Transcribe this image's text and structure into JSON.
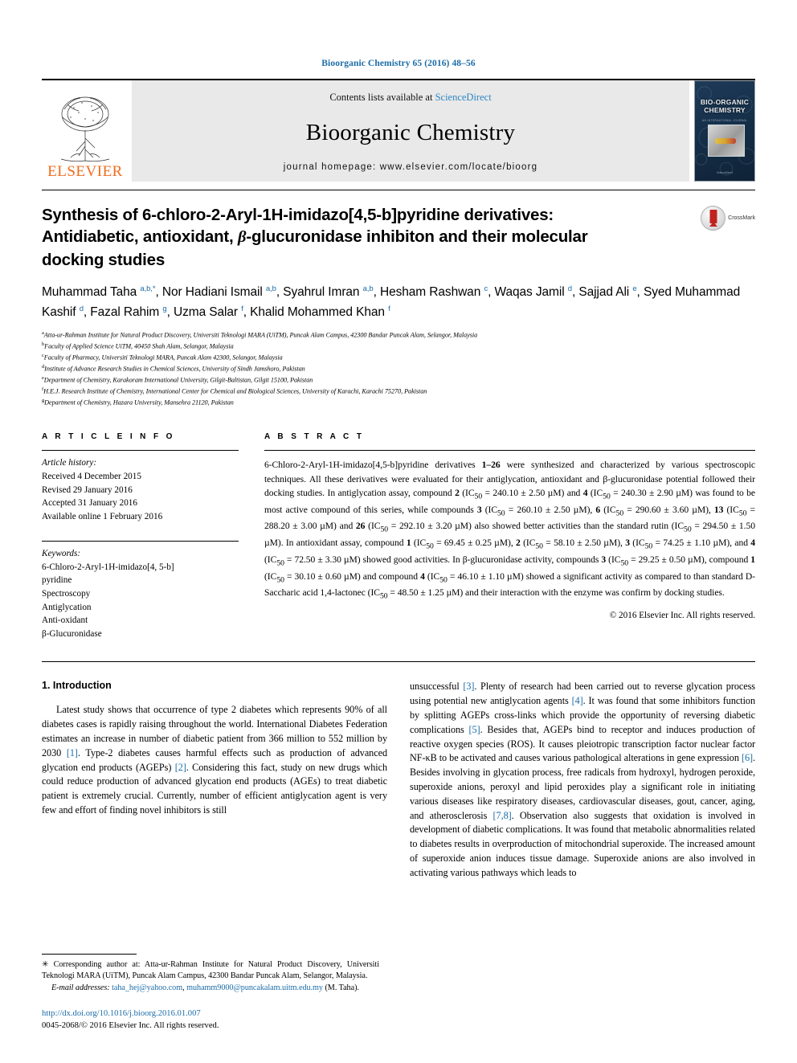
{
  "running_head": "Bioorganic Chemistry 65 (2016) 48–56",
  "masthead": {
    "publisher": "ELSEVIER",
    "contents_prefix": "Contents lists available at ",
    "sciencedirect": "ScienceDirect",
    "journal_name": "Bioorganic Chemistry",
    "homepage": "journal homepage: www.elsevier.com/locate/bioorg",
    "cover": {
      "line1": "BIO-ORGANIC",
      "line2": "CHEMISTRY",
      "sub": "AN INTERNATIONAL JOURNAL",
      "foot": "ScienceDirect"
    }
  },
  "article": {
    "title_line1": "Synthesis of 6-chloro-2-Aryl-1H-imidazo[4,5-b]pyridine derivatives:",
    "title_line2_pre": "Antidiabetic, antioxidant, ",
    "title_line2_beta": "β",
    "title_line2_post": "-glucuronidase inhibiton and their molecular",
    "title_line3": "docking studies",
    "crossmark_label": "CrossMark",
    "authors": [
      {
        "name": "Muhammad Taha ",
        "sup": "a,b,*",
        "sep": ", "
      },
      {
        "name": "Nor Hadiani Ismail ",
        "sup": "a,b",
        "sep": ", "
      },
      {
        "name": "Syahrul Imran ",
        "sup": "a,b",
        "sep": ", "
      },
      {
        "name": "Hesham Rashwan ",
        "sup": "c",
        "sep": ", "
      },
      {
        "name": "Waqas Jamil ",
        "sup": "d",
        "sep": ", "
      },
      {
        "name": "Sajjad Ali ",
        "sup": "e",
        "sep": ", "
      },
      {
        "name": "Syed Muhammad Kashif ",
        "sup": "d",
        "sep": ", "
      },
      {
        "name": "Fazal Rahim ",
        "sup": "g",
        "sep": ", "
      },
      {
        "name": "Uzma Salar ",
        "sup": "f",
        "sep": ", "
      },
      {
        "name": "Khalid Mohammed Khan ",
        "sup": "f",
        "sep": ""
      }
    ],
    "affiliations": [
      {
        "mark": "a",
        "text": "Atta-ur-Rahman Institute for Natural Product Discovery, Universiti Teknologi MARA (UiTM), Puncak Alam Campus, 42300 Bandar Puncak Alam, Selangor, Malaysia"
      },
      {
        "mark": "b",
        "text": "Faculty of Applied Science UiTM, 40450 Shah Alam, Selangor, Malaysia"
      },
      {
        "mark": "c",
        "text": "Faculty of Pharmacy, Universiti Teknologi MARA, Puncak Alam 42300, Selangor, Malaysia"
      },
      {
        "mark": "d",
        "text": "Institute of Advance Research Studies in Chemical Sciences, University of Sindh Jamshoro, Pakistan"
      },
      {
        "mark": "e",
        "text": "Department of Chemistry, Karakoram International University, Gilgit-Baltistan, Gilgit 15100, Pakistan"
      },
      {
        "mark": "f",
        "text": "H.E.J. Research Institute of Chemistry, International Center for Chemical and Biological Sciences, University of Karachi, Karachi 75270, Pakistan"
      },
      {
        "mark": "g",
        "text": "Department of Chemistry, Hazara University, Mansehra 21120, Pakistan"
      }
    ]
  },
  "article_info": {
    "heading": "A R T I C L E   I N F O",
    "history_label": "Article history:",
    "history": [
      "Received 4 December 2015",
      "Revised 29 January 2016",
      "Accepted 31 January 2016",
      "Available online 1 February 2016"
    ],
    "keywords_label": "Keywords:",
    "keywords": [
      "6-Chloro-2-Aryl-1H-imidazo[4, 5-b]",
      "pyridine",
      "Spectroscopy",
      "Antiglycation",
      "Anti-oxidant",
      "β-Glucuronidase"
    ]
  },
  "abstract": {
    "heading": "A B S T R A C T",
    "text_html": "6-Chloro-2-Aryl-1H-imidazo[4,5-b]pyridine derivatives <b>1&#8211;26</b> were synthesized and characterized by various spectroscopic techniques. All these derivatives were evaluated for their antiglycation, antioxidant and &#946;-glucuronidase potential followed their docking studies. In antiglycation assay, compound <b>2</b> (IC<sub>50</sub> = 240.10 &#177; 2.50 &#181;M) and <b>4</b> (IC<sub>50</sub> = 240.30 &#177; 2.90 &#181;M) was found to be most active compound of this series, while compounds <b>3</b> (IC<sub>50</sub> = 260.10 &#177; 2.50 &#181;M), <b>6</b> (IC<sub>50</sub> = 290.60 &#177; 3.60 &#181;M), <b>13</b> (IC<sub>50</sub> = 288.20 &#177; 3.00 &#181;M) and <b>26</b> (IC<sub>50</sub> = 292.10 &#177; 3.20 &#181;M) also showed better activities than the standard rutin (IC<sub>50</sub> = 294.50 &#177; 1.50 &#181;M). In antioxidant assay, compound <b>1</b> (IC<sub>50</sub> = 69.45 &#177; 0.25 &#181;M), <b>2</b> (IC<sub>50</sub> = 58.10 &#177; 2.50 &#181;M), <b>3</b> (IC<sub>50</sub> = 74.25 &#177; 1.10 &#181;M), and <b>4</b> (IC<sub>50</sub> = 72.50 &#177; 3.30 &#181;M) showed good activities. In &#946;-glucuronidase activity, compounds <b>3</b> (IC<sub>50</sub> = 29.25 &#177; 0.50 &#181;M), compound <b>1</b> (IC<sub>50</sub> = 30.10 &#177; 0.60 &#181;M) and compound <b>4</b> (IC<sub>50</sub> = 46.10 &#177; 1.10 &#181;M) showed a significant activity as compared to than standard D-Saccharic acid 1,4-lactonec (IC<sub>50</sub> = 48.50 &#177; 1.25 &#181;M) and their interaction with the enzyme was confirm by docking studies.",
    "copyright": "© 2016 Elsevier Inc. All rights reserved."
  },
  "introduction": {
    "heading": "1. Introduction",
    "left_html": "Latest study shows that occurrence of type 2 diabetes which represents 90% of all diabetes cases is rapidly raising throughout the world. International Diabetes Federation estimates an increase in number of diabetic patient from 366 million to 552 million by 2030 <span class=\"ref\">[1]</span>. Type-2 diabetes causes harmful effects such as production of advanced glycation end products (AGEPs) <span class=\"ref\">[2]</span>. Considering this fact, study on new drugs which could reduce production of advanced glycation end products (AGEs) to treat diabetic patient is extremely crucial. Currently, number of efficient antiglycation agent is very few and effort of finding novel inhibitors is still",
    "right_html": "unsuccessful <span class=\"ref\">[3]</span>. Plenty of research had been carried out to reverse glycation process using potential new antiglycation agents <span class=\"ref\">[4]</span>. It was found that some inhibitors function by splitting AGEPs cross-links which provide the opportunity of reversing diabetic complications <span class=\"ref\">[5]</span>. Besides that, AGEPs bind to receptor and induces production of reactive oxygen species (ROS). It causes pleiotropic transcription factor nuclear factor NF-&#954;B to be activated and causes various pathological alterations in gene expression <span class=\"ref\">[6]</span>. Besides involving in glycation process, free radicals from hydroxyl, hydrogen peroxide, superoxide anions, peroxyl and lipid peroxides play a significant role in initiating various diseases like respiratory diseases, cardiovascular diseases, gout, cancer, aging, and atherosclerosis <span class=\"ref\">[7,8]</span>. Observation also suggests that oxidation is involved in development of diabetic complications. It was found that metabolic abnormalities related to diabetes results in overproduction of mitochondrial superoxide. The increased amount of superoxide anion induces tissue damage. Superoxide anions are also involved in activating various pathways which leads to"
  },
  "footnote": {
    "corresponding_html": "&#10035; Corresponding author at: Atta-ur-Rahman Institute for Natural Product Discovery, Universiti Teknologi MARA (UiTM), Puncak Alam Campus, 42300 Bandar Puncak Alam, Selangor, Malaysia.",
    "email_html": "<span class=\"ital\">E-mail addresses:</span> <span class=\"link\">taha_hej@yahoo.com</span>, <span class=\"link\">muhamm9000@puncakalam.uitm.edu.my</span> (M. Taha).",
    "doi": "http://dx.doi.org/10.1016/j.bioorg.2016.01.007",
    "issn_line": "0045-2068/© 2016 Elsevier Inc. All rights reserved."
  },
  "colors": {
    "accent_blue": "#1b6ca8",
    "sciencedirect_blue": "#2d86c4",
    "elsevier_orange": "#f06c1e",
    "band_gray": "#e9e9e9"
  }
}
